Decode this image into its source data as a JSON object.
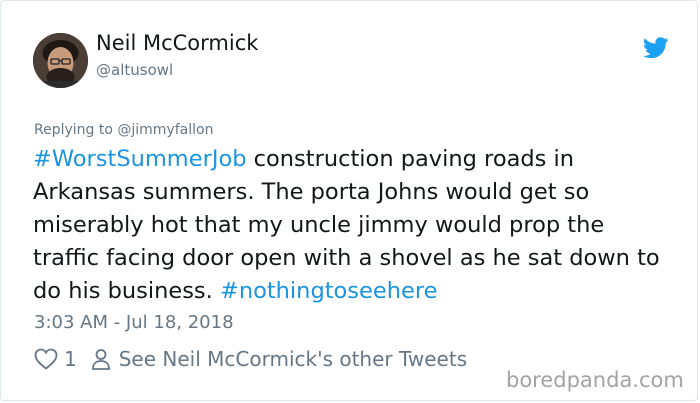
{
  "user": {
    "name": "Neil McCormick",
    "handle": "@altusowl"
  },
  "reply": {
    "prefix": "Replying to ",
    "mention": "@jimmyfallon"
  },
  "tweet": {
    "hashtag1": "#WorstSummerJob",
    "body": " construction paving roads in Arkansas summers. The porta Johns would get so miserably hot that my uncle jimmy would prop the traffic facing door open with a shovel as he sat down to do his business. ",
    "hashtag2": "#nothingtoseehere"
  },
  "timestamp": "3:03 AM - Jul 18, 2018",
  "actions": {
    "likes": "1",
    "see_other": "See Neil McCormick's other Tweets"
  },
  "watermark": "boredpanda.com",
  "colors": {
    "link": "#1b95e0",
    "muted": "#657786",
    "twitter_blue": "#1da1f2"
  },
  "icons": {
    "avatar": "user-avatar",
    "logo": "twitter-bird-icon",
    "like": "heart-icon",
    "profile": "person-icon"
  }
}
